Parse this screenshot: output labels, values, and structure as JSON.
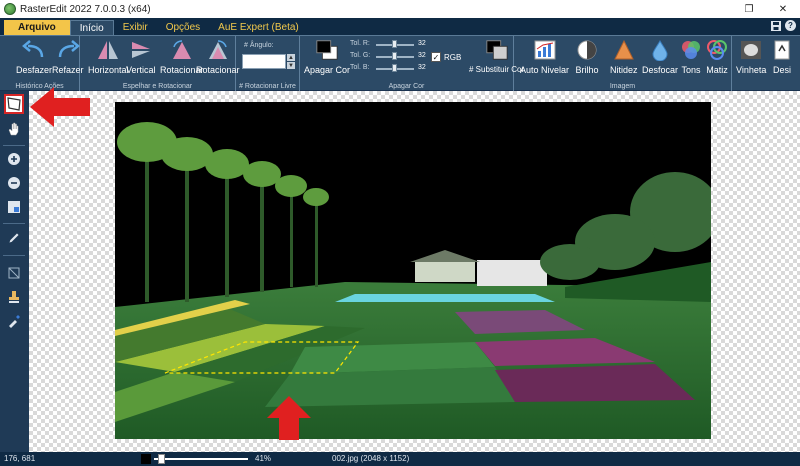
{
  "window": {
    "title": "RasterEdit 2022 7.0.0.3 (x64)",
    "restore_glyph": "❐",
    "close_glyph": "✕"
  },
  "menu": {
    "file": "Arquivo",
    "tabs": [
      "Início",
      "Exibir",
      "Opções",
      "AuE Expert (Beta)"
    ],
    "save_glyph": "💾",
    "help_glyph": "?"
  },
  "ribbon": {
    "history": {
      "undo": "Desfazer",
      "redo": "Refazer",
      "label": "Histórico Ações"
    },
    "mirror_rotate": {
      "horizontal": "Horizontal",
      "vertical": "Vertical",
      "rotate_left": "Rotacionar",
      "rotate_right": "Rotacionar",
      "label": "Espelhar e Rotacionar"
    },
    "free_rotate": {
      "angle_label": "# Ângulo:",
      "angle_value": "",
      "label": "# Rotacionar Livre"
    },
    "erase_color": {
      "erase_btn": "Apagar Cor",
      "tol_r": "Tol. R:",
      "tol_g": "Tol. G:",
      "tol_b": "Tol. B:",
      "tol_r_value": "32",
      "tol_g_value": "32",
      "tol_b_value": "32",
      "rgb_label": "RGB",
      "rgb_checked": "✓",
      "replace_btn": "# Substituir Cor",
      "label": "Apagar Cor"
    },
    "image": {
      "auto_level": "Auto Nivelar",
      "brightness": "Brilho",
      "sharpness": "Nitidez",
      "blur": "Desfocar",
      "tones": "Tons",
      "hue": "Matiz",
      "label": "Imagem"
    },
    "effects": {
      "vignette": "Vinheta",
      "desaturate": "Desi"
    }
  },
  "toolbar": {
    "tools": [
      "crop-select",
      "pan",
      "zoom-in",
      "zoom-out",
      "fit",
      "pencil",
      "crop",
      "stamp",
      "eyedropper"
    ]
  },
  "status": {
    "coords": "176, 681",
    "zoom_percent": "41%",
    "zoom_fraction": 0.41,
    "file_info": "002.jpg (2048 x 1152)"
  },
  "colors": {
    "accent_yellow": "#f3c549",
    "ribbon": "#2c4a66",
    "window_bg": "#0f2a44",
    "annotation_red": "#e02020",
    "selection_dash": "#ffe600"
  }
}
